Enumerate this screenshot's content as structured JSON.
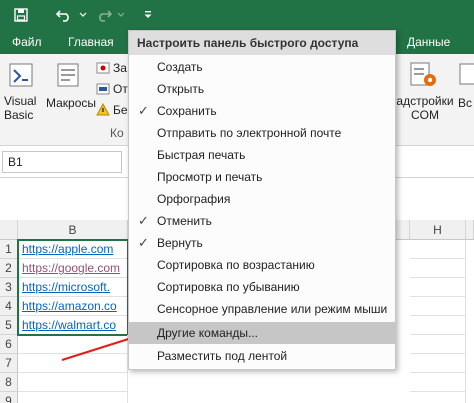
{
  "qat": {
    "save": "save-icon",
    "undo": "undo-icon",
    "redo": "redo-icon",
    "customize": "customize-qat-icon"
  },
  "ribbon_tabs": [
    "Файл",
    "Главная",
    "Данные"
  ],
  "ribbon": {
    "visual_basic": "Visual\nBasic",
    "macros": "Макросы",
    "partial_items": [
      "За",
      "От",
      "Бе"
    ],
    "partial_group": "Ко",
    "addins_com": "адстройки\nCOM",
    "partial_right": "Вс"
  },
  "name_box": "B1",
  "grid": {
    "columns": [
      "B",
      "H"
    ],
    "rows": [
      "1",
      "2",
      "3",
      "4",
      "5",
      "6",
      "7",
      "8",
      "9"
    ],
    "cells": [
      {
        "text": "https://apple.com",
        "visited": false
      },
      {
        "text": "https://google.com",
        "visited": true
      },
      {
        "text": "https://microsoft.",
        "visited": false
      },
      {
        "text": "https://amazon.co",
        "visited": false
      },
      {
        "text": "https://walmart.co",
        "visited": false
      }
    ]
  },
  "menu": {
    "title": "Настроить панель быстрого доступа",
    "items": [
      {
        "label": "Создать",
        "checked": false
      },
      {
        "label": "Открыть",
        "checked": false
      },
      {
        "label": "Сохранить",
        "checked": true
      },
      {
        "label": "Отправить по электронной почте",
        "checked": false
      },
      {
        "label": "Быстрая печать",
        "checked": false
      },
      {
        "label": "Просмотр и печать",
        "checked": false
      },
      {
        "label": "Орфография",
        "checked": false
      },
      {
        "label": "Отменить",
        "checked": true
      },
      {
        "label": "Вернуть",
        "checked": true
      },
      {
        "label": "Сортировка по возрастанию",
        "checked": false
      },
      {
        "label": "Сортировка по убыванию",
        "checked": false
      },
      {
        "label": "Сенсорное управление или режим мыши",
        "checked": false
      },
      {
        "label": "Другие команды...",
        "checked": false,
        "highlighted": true
      },
      {
        "label": "Разместить под лентой",
        "checked": false
      }
    ]
  },
  "colors": {
    "excel_green": "#217346",
    "link": "#0563c1",
    "link_visited": "#954f72",
    "annotation_arrow": "#e0201b"
  }
}
